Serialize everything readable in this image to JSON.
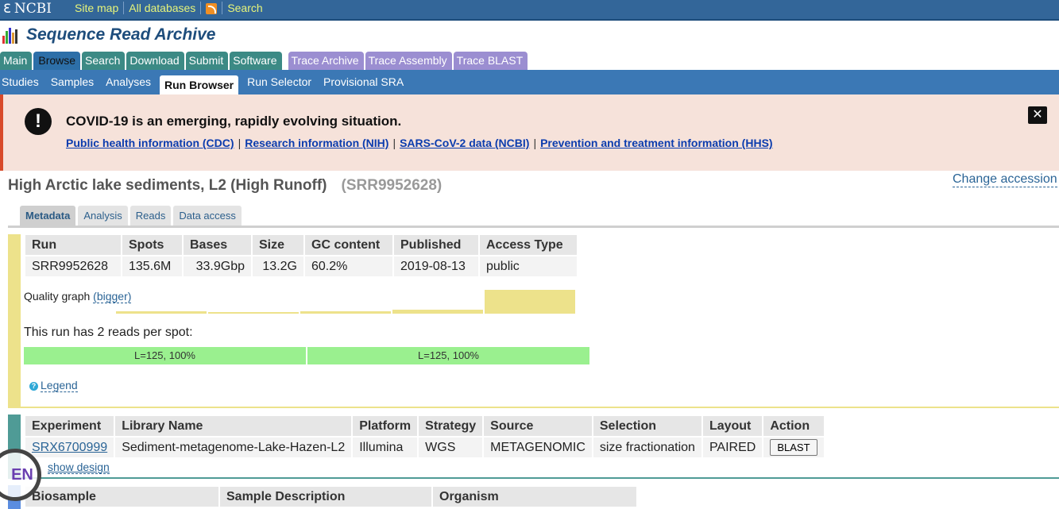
{
  "ncbi": {
    "logo": "NCBI",
    "links": [
      "Site map",
      "All databases",
      "Search"
    ]
  },
  "app_title": "Sequence Read Archive",
  "main_tabs": [
    "Main",
    "Browse",
    "Search",
    "Download",
    "Submit",
    "Software"
  ],
  "trace_tabs": [
    "Trace Archive",
    "Trace Assembly",
    "Trace BLAST"
  ],
  "sub_tabs": [
    "Studies",
    "Samples",
    "Analyses",
    "Run Browser",
    "Run Selector",
    "Provisional SRA"
  ],
  "covid": {
    "headline": "COVID-19 is an emerging, rapidly evolving situation.",
    "links": [
      "Public health information (CDC)",
      "Research information (NIH)",
      "SARS-CoV-2 data (NCBI)",
      "Prevention and treatment information (HHS)"
    ],
    "separator": "|"
  },
  "run_header": {
    "title": "High Arctic lake sediments, L2 (High Runoff)",
    "accession": "(SRR9952628)",
    "change_link": "Change accession"
  },
  "detail_tabs": [
    "Metadata",
    "Analysis",
    "Reads",
    "Data access"
  ],
  "run_table": {
    "headers": [
      "Run",
      "Spots",
      "Bases",
      "Size",
      "GC content",
      "Published",
      "Access Type"
    ],
    "row": [
      "SRR9952628",
      "135.6M",
      "33.9Gbp",
      "13.2G",
      "60.2%",
      "2019-08-13",
      "public"
    ]
  },
  "quality": {
    "label": "Quality graph",
    "link": "(bigger)"
  },
  "reads": {
    "note": "This run has 2 reads per spot:",
    "bars": [
      "L=125, 100%",
      "L=125, 100%"
    ]
  },
  "legend_link": "Legend",
  "experiment_table": {
    "headers": [
      "Experiment",
      "Library Name",
      "Platform",
      "Strategy",
      "Source",
      "Selection",
      "Layout",
      "Action"
    ],
    "row": [
      "SRX6700999",
      "Sediment-metagenome-Lake-Hazen-L2",
      "Illumina",
      "WGS",
      "METAGENOMIC",
      "size fractionation",
      "PAIRED"
    ],
    "action_button": "BLAST"
  },
  "show_design": "show design",
  "biosample_table": {
    "headers": [
      "Biosample",
      "Sample Description",
      "Organism"
    ]
  },
  "language_badge": "EN",
  "colors": {
    "ncbi_bar": "#336699",
    "tab_teal": "#3c8a85",
    "tab_purple": "#9b8ed1",
    "subnav": "#3b78b5",
    "covid_bg": "#f6e2da",
    "run_accent": "#ede28b",
    "exp_accent": "#4f9b96",
    "bio_accent": "#5b8de0",
    "read_bar": "#9af08f"
  }
}
